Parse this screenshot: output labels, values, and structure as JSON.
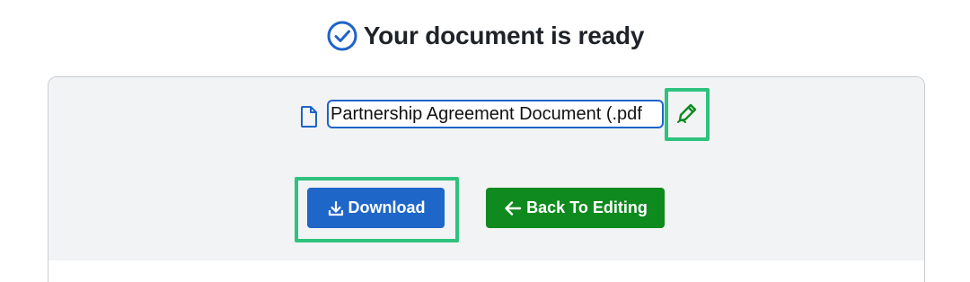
{
  "header": {
    "title": "Your document is ready",
    "status_icon": "check-circle-icon",
    "status_color": "#1e63c8"
  },
  "file": {
    "icon": "file-icon",
    "name_value": "Partnership Agreement Document (.pdf",
    "edit_icon": "edit-pen-icon"
  },
  "actions": {
    "download_label": "Download",
    "download_icon": "download-icon",
    "download_color": "#1f66c9",
    "back_label": "Back To Editing",
    "back_icon": "arrow-left-icon",
    "back_color": "#0f8a1f"
  },
  "highlight_color": "#2ec27e"
}
